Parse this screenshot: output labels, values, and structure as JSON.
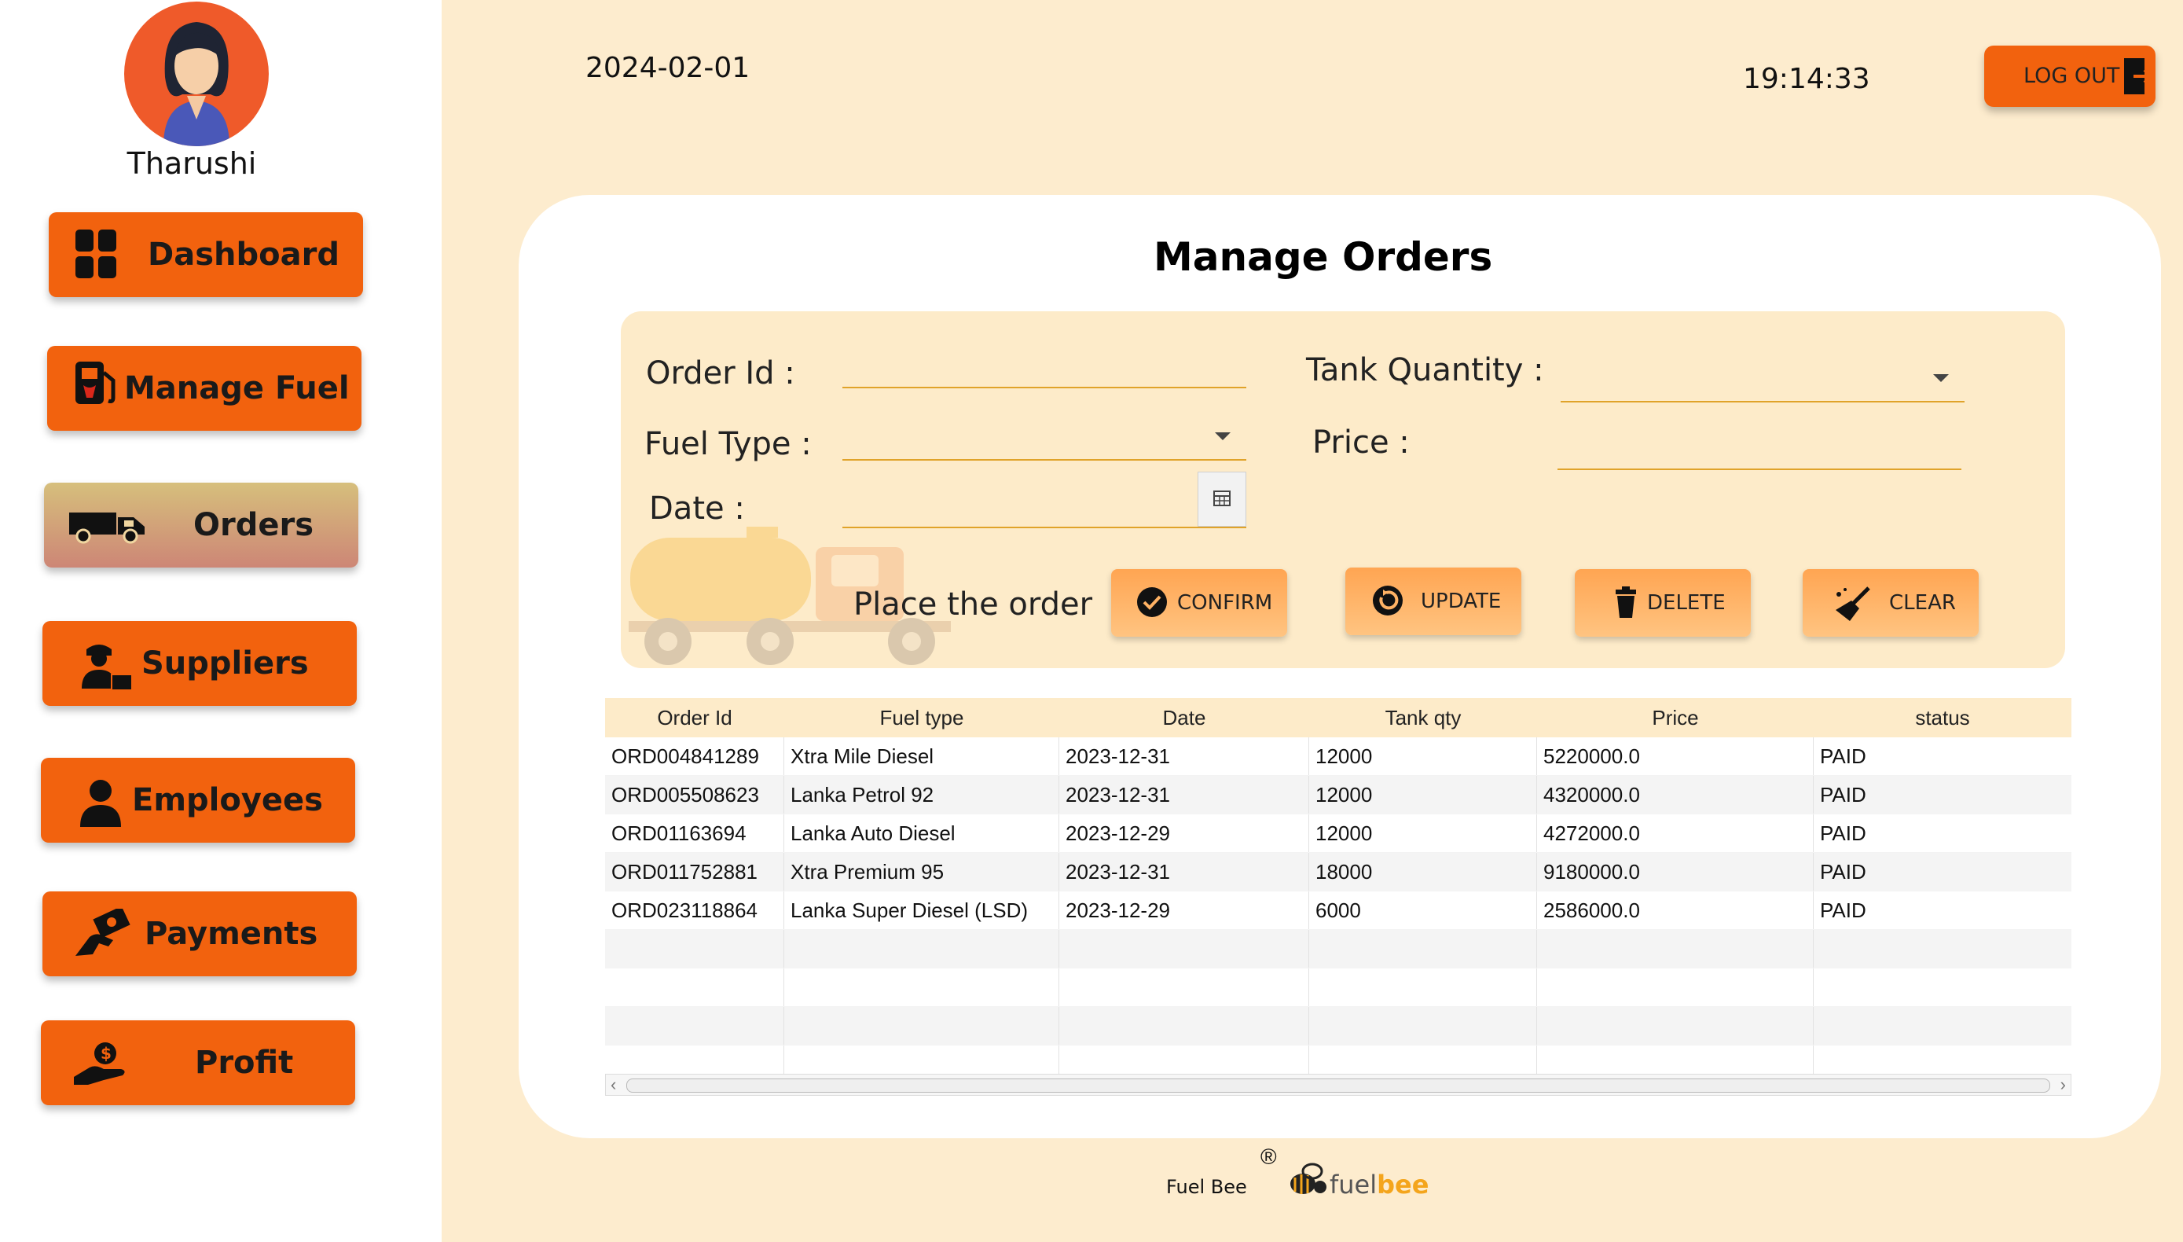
{
  "user": {
    "name": "Tharushi"
  },
  "sidebar": {
    "items": [
      {
        "label": "Dashboard",
        "icon": "grid-icon"
      },
      {
        "label": "Manage Fuel",
        "icon": "fuel-pump-icon"
      },
      {
        "label": "Orders",
        "icon": "truck-icon",
        "active": true
      },
      {
        "label": "Suppliers",
        "icon": "delivery-person-icon"
      },
      {
        "label": "Employees",
        "icon": "person-icon"
      },
      {
        "label": "Payments",
        "icon": "hand-cash-icon"
      },
      {
        "label": "Profit",
        "icon": "hand-coin-icon"
      }
    ]
  },
  "header": {
    "date": "2024-02-01",
    "time": "19:14:33",
    "logout_label": "LOG OUT"
  },
  "page": {
    "title": "Manage Orders"
  },
  "form": {
    "order_id_label": "Order Id  :",
    "fuel_type_label": "Fuel Type  :",
    "date_label": "Date  :",
    "tank_quantity_label": "Tank Quantity :",
    "price_label": "Price  :",
    "order_id_value": "",
    "fuel_type_value": "",
    "date_value": "",
    "tank_quantity_value": "",
    "price_value": "",
    "place_order_label": "Place the order"
  },
  "actions": {
    "confirm": "CONFIRM",
    "update": "UPDATE",
    "delete": "DELETE",
    "clear": "CLEAR"
  },
  "table": {
    "headers": [
      "Order Id",
      "Fuel type",
      "Date",
      "Tank qty",
      "Price",
      "status"
    ],
    "rows": [
      [
        "ORD004841289",
        "Xtra Mile Diesel",
        "2023-12-31",
        "12000",
        "5220000.0",
        "PAID"
      ],
      [
        "ORD005508623",
        "Lanka Petrol 92",
        "2023-12-31",
        "12000",
        "4320000.0",
        "PAID"
      ],
      [
        "ORD01163694",
        "Lanka Auto Diesel",
        "2023-12-29",
        "12000",
        "4272000.0",
        "PAID"
      ],
      [
        "ORD011752881",
        "Xtra Premium 95",
        "2023-12-31",
        "18000",
        "9180000.0",
        "PAID"
      ],
      [
        "ORD023118864",
        "Lanka Super Diesel (LSD)",
        "2023-12-29",
        "6000",
        "2586000.0",
        "PAID"
      ]
    ]
  },
  "footer": {
    "brand_text": "Fuel Bee",
    "registered": "®",
    "logo_part1": "fuel",
    "logo_part2": "bee"
  },
  "colors": {
    "accent": "#f2620e",
    "background": "#fdecce",
    "panel": "#fdebc9",
    "button": "#ffb264"
  }
}
